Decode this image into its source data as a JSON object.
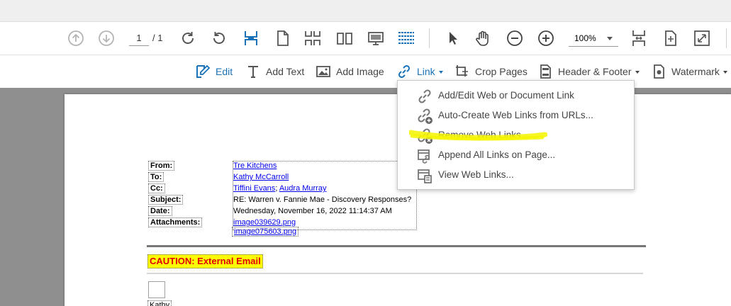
{
  "toolbar": {
    "page_current": "1",
    "page_total": "/ 1",
    "zoom": "100%",
    "icons": [
      "prev-page-icon",
      "next-page-icon",
      "rotate-cw-icon",
      "rotate-ccw-icon",
      "fit-width-icon",
      "single-page-icon",
      "scroll-pages-icon",
      "two-page-icon",
      "presentation-icon",
      "read-mode-icon",
      "select-cursor-icon",
      "hand-tool-icon",
      "zoom-out-icon",
      "zoom-in-icon",
      "split-view-icon",
      "fit-page-icon",
      "full-screen-icon"
    ]
  },
  "edit_bar": {
    "edit": "Edit",
    "add_text": "Add Text",
    "add_image": "Add Image",
    "link": "Link",
    "crop_pages": "Crop Pages",
    "header_footer": "Header & Footer",
    "watermark": "Watermark"
  },
  "link_menu": {
    "items": [
      {
        "label": "Add/Edit Web or Document Link",
        "icon": "link-edit-icon"
      },
      {
        "label": "Auto-Create Web Links from URLs...",
        "icon": "link-add-icon"
      },
      {
        "label": "Remove Web Links...",
        "icon": "link-remove-icon"
      },
      {
        "label": "Append All Links on Page...",
        "icon": "append-links-icon"
      },
      {
        "label": "View Web Links...",
        "icon": "view-links-icon"
      }
    ],
    "highlight_color": "#f5f500"
  },
  "email": {
    "labels": {
      "from": "From:",
      "to": "To:",
      "cc": "Cc:",
      "subject": "Subject:",
      "date": "Date:",
      "attachments": "Attachments:"
    },
    "from": "Tre Kitchens",
    "to": "Kathy McCarroll",
    "cc1": "Tiffini Evans",
    "cc_sep": ";",
    "cc2": "Audra Murray",
    "subject": "RE: Warren v. Fannie Mae - Discovery Responses?",
    "date": "Wednesday, November 16, 2022 11:14:37 AM",
    "attachment1": "image039629.png",
    "attachment2": "image075603.png",
    "caution": "CAUTION: External Email",
    "signature": "Kathy"
  },
  "colors": {
    "accent_blue": "#1a73b8",
    "caution_red": "#e00000",
    "caution_bg": "#ffff00",
    "viewer_gray": "#8f8f8f"
  }
}
